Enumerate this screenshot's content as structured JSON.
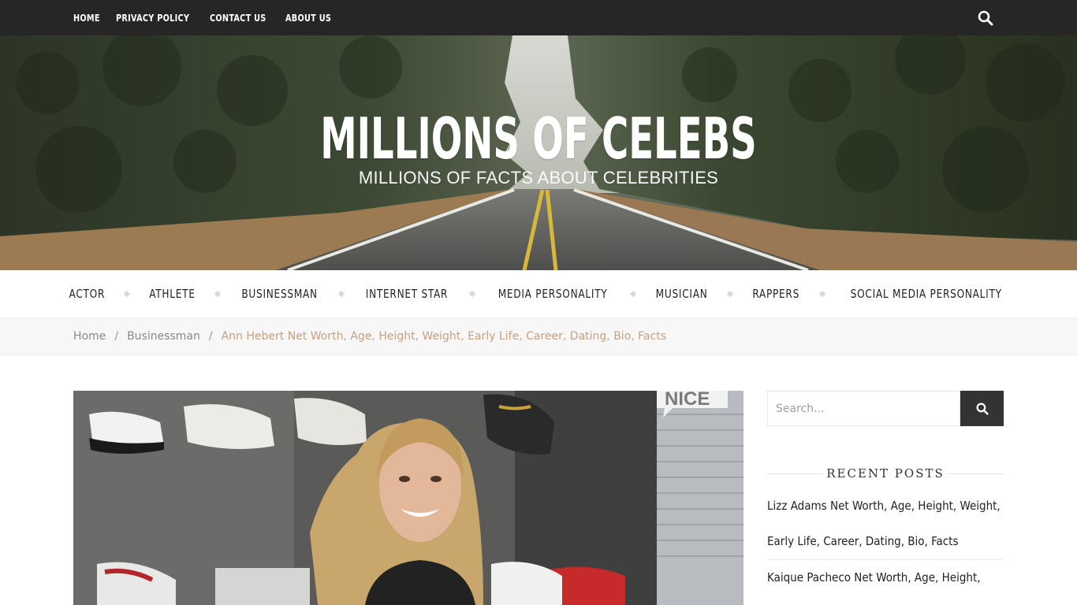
{
  "topnav": {
    "items": [
      "HOME",
      "PRIVACY POLICY",
      "CONTACT US",
      "ABOUT US"
    ]
  },
  "header": {
    "site_title": "MILLIONS OF CELEBS",
    "tagline": "MILLIONS OF FACTS ABOUT CELEBRITIES"
  },
  "mainnav": {
    "items": [
      "ACTOR",
      "ATHLETE",
      "BUSINESSMAN",
      "INTERNET STAR",
      "MEDIA PERSONALITY",
      "MUSICIAN",
      "RAPPERS",
      "SOCIAL MEDIA PERSONALITY"
    ]
  },
  "breadcrumb": {
    "home": "Home",
    "category": "Businessman",
    "current": "Ann Hebert Net Worth, Age, Height, Weight, Early Life, Career, Dating, Bio, Facts",
    "separator": "/"
  },
  "featured_image": {
    "sign_text": "NICE"
  },
  "sidebar": {
    "search_placeholder": "Search...",
    "recent_posts_title": "RECENT POSTS",
    "recent_posts": [
      "Lizz Adams Net Worth, Age, Height, Weight, Early Life, Career, Dating, Bio, Facts",
      "Kaique Pacheco Net Worth, Age, Height,"
    ]
  },
  "colors": {
    "topbar_bg": "#262626",
    "breadcrumb_current": "#c8a07e",
    "search_button_bg": "#333333"
  },
  "icons": {
    "top_search": "search-icon",
    "sidebar_search": "search-icon"
  }
}
